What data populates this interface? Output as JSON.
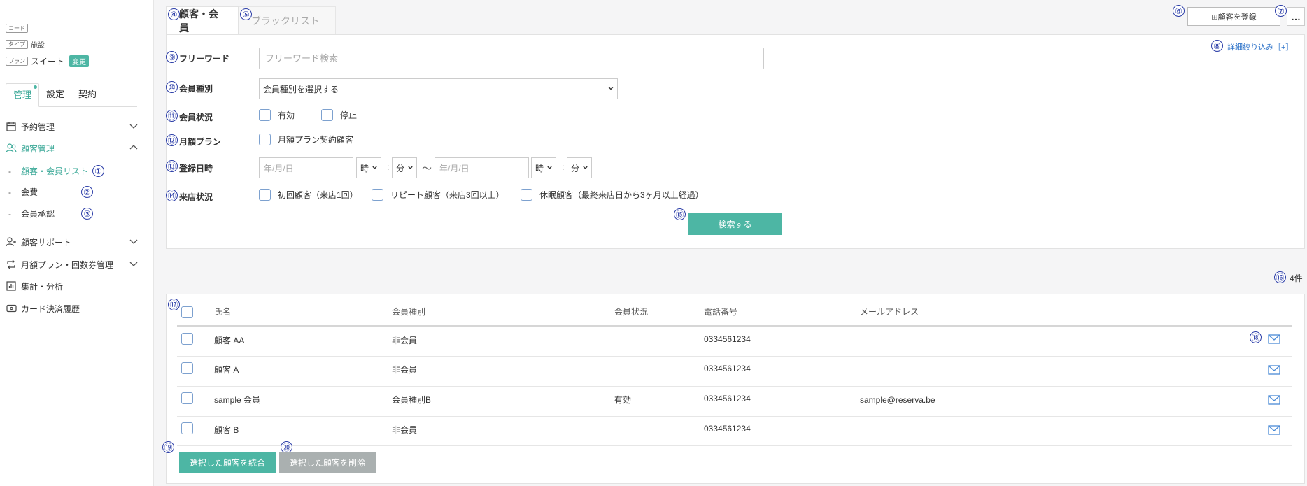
{
  "sidebar": {
    "code_tag": "コード",
    "type_tag": "タイプ",
    "type_value": "施設",
    "plan_tag": "プラン",
    "plan_value": "スイート",
    "change_badge": "変更",
    "tabs": [
      {
        "label": "管理",
        "active": true
      },
      {
        "label": "設定",
        "active": false
      },
      {
        "label": "契約",
        "active": false
      }
    ],
    "nav": {
      "reservation": "予約管理",
      "customer": "顧客管理",
      "customer_sub": [
        {
          "label": "顧客・会員リスト",
          "marker": "①",
          "active": true
        },
        {
          "label": "会費",
          "marker": "②",
          "active": false
        },
        {
          "label": "会員承認",
          "marker": "③",
          "active": false
        }
      ],
      "support": "顧客サポート",
      "monthly": "月額プラン・回数券管理",
      "stats": "集計・分析",
      "card": "カード決済履歴"
    }
  },
  "tabs": [
    {
      "label": "顧客・会員",
      "marker": "④",
      "active": true
    },
    {
      "label": "ブラックリスト",
      "marker": "⑤",
      "active": false
    }
  ],
  "header": {
    "register_marker": "⑥",
    "register_label": "⊞顧客を登録",
    "more_marker": "⑦",
    "more_label": "…",
    "detail_marker": "⑧",
    "detail_label": "詳細絞り込み［+］"
  },
  "search": {
    "freeword": {
      "marker": "⑨",
      "label": "フリーワード",
      "placeholder": "フリーワード検索",
      "value": ""
    },
    "member_type": {
      "marker": "⑩",
      "label": "会員種別",
      "selected": "会員種別を選択する"
    },
    "member_status": {
      "marker": "⑪",
      "label": "会員状況",
      "options": [
        "有効",
        "停止"
      ]
    },
    "monthly_plan": {
      "marker": "⑫",
      "label": "月額プラン",
      "option": "月額プラン契約顧客"
    },
    "registered": {
      "marker": "⑬",
      "label": "登録日時",
      "date_placeholder": "年/月/日",
      "hour": "時",
      "minute": "分",
      "colon": ":",
      "tilde": "〜"
    },
    "visit_status": {
      "marker": "⑭",
      "label": "来店状況",
      "options": [
        "初回顧客（来店1回）",
        "リピート顧客（来店3回以上）",
        "休眠顧客（最終来店日から3ヶ月以上経過）"
      ]
    },
    "submit": {
      "marker": "⑮",
      "label": "検索する"
    }
  },
  "results": {
    "count_marker": "⑯",
    "count_label": "4件",
    "select_all_marker": "⑰",
    "mail_marker": "⑱",
    "columns": [
      "氏名",
      "会員種別",
      "会員状況",
      "電話番号",
      "メールアドレス"
    ],
    "rows": [
      {
        "name": "顧客 AA",
        "type": "非会員",
        "status": "",
        "phone": "0334561234",
        "email": ""
      },
      {
        "name": "顧客 A",
        "type": "非会員",
        "status": "",
        "phone": "0334561234",
        "email": ""
      },
      {
        "name": "sample 会員",
        "type": "会員種別B",
        "status": "有効",
        "phone": "0334561234",
        "email": "sample@reserva.be"
      },
      {
        "name": "顧客 B",
        "type": "非会員",
        "status": "",
        "phone": "0334561234",
        "email": ""
      }
    ],
    "merge": {
      "marker": "⑲",
      "label": "選択した顧客を統合"
    },
    "delete": {
      "marker": "⑳",
      "label": "選択した顧客を削除"
    }
  },
  "colors": {
    "accent": "#4db6a4",
    "link": "#2c72c9",
    "marker": "#2c3ea8",
    "disabled": "#aab0b0"
  }
}
